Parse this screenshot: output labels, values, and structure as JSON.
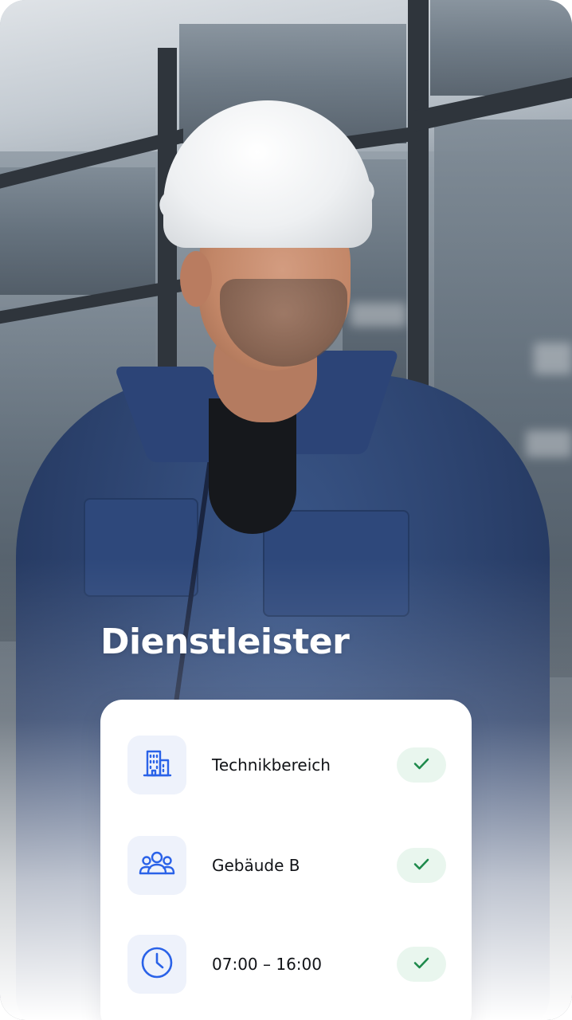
{
  "headline": "Dienstleister",
  "items": [
    {
      "label": "Technikbereich",
      "icon": "building-icon",
      "status": "check-icon"
    },
    {
      "label": "Gebäude B",
      "icon": "group-icon",
      "status": "check-icon"
    },
    {
      "label": "07:00 – 16:00",
      "icon": "clock-icon",
      "status": "check-icon"
    }
  ],
  "colors": {
    "accent_blue": "#2a62e8",
    "icon_tile_bg": "#eef2fb",
    "check_green": "#1f8a4c",
    "check_pill_bg": "#e9f6ee"
  }
}
